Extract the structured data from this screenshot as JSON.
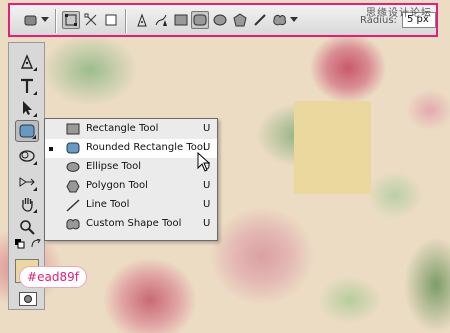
{
  "options_bar": {
    "radius_label": "Radius:",
    "radius_value": "5 px",
    "watermark": "思缘设计论坛"
  },
  "flyout_menu": {
    "items": [
      {
        "label": "Rectangle Tool",
        "key": "U",
        "icon": "rectangle-icon"
      },
      {
        "label": "Rounded Rectangle Tool",
        "key": "U",
        "icon": "rounded-rectangle-icon",
        "selected": true
      },
      {
        "label": "Ellipse Tool",
        "key": "U",
        "icon": "ellipse-icon"
      },
      {
        "label": "Polygon Tool",
        "key": "U",
        "icon": "polygon-icon"
      },
      {
        "label": "Line Tool",
        "key": "U",
        "icon": "line-icon"
      },
      {
        "label": "Custom Shape Tool",
        "key": "U",
        "icon": "custom-shape-icon"
      }
    ]
  },
  "foreground_color": {
    "hex_label": "#ead89f",
    "value": "#ead89f"
  },
  "colors": {
    "accent": "#e0207a",
    "swatch": "#ead89f",
    "shape_fill": "#6b98bf"
  }
}
